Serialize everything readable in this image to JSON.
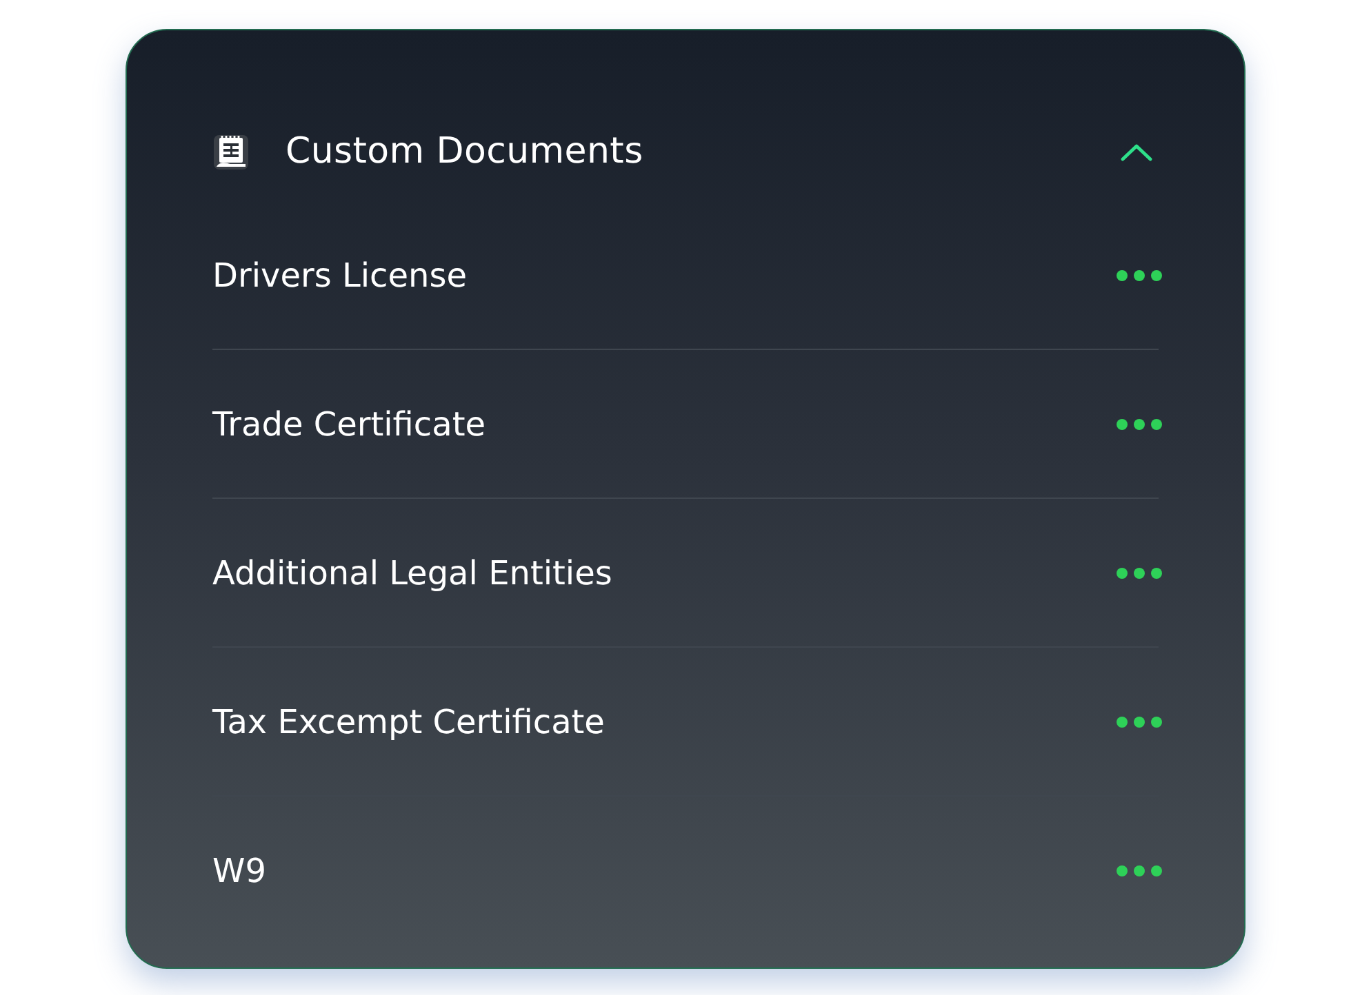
{
  "section": {
    "title": "Custom Documents",
    "expanded": true
  },
  "documents": [
    {
      "name": "Drivers License"
    },
    {
      "name": "Trade Certificate"
    },
    {
      "name": "Additional Legal Entities"
    },
    {
      "name": "Tax Excempt Certificate"
    },
    {
      "name": "W9"
    }
  ]
}
